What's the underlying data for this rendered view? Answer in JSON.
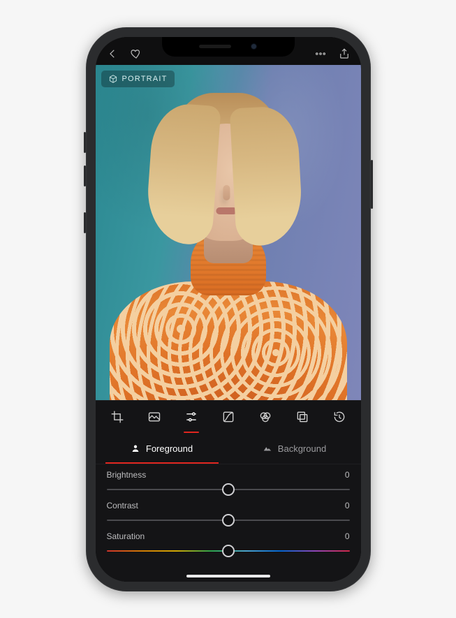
{
  "badge": {
    "label": "PORTRAIT"
  },
  "toolbar": {
    "tools": [
      {
        "name": "crop"
      },
      {
        "name": "presets"
      },
      {
        "name": "adjust",
        "active": true
      },
      {
        "name": "curves"
      },
      {
        "name": "color-mix"
      },
      {
        "name": "frame"
      },
      {
        "name": "history"
      }
    ]
  },
  "tabs": {
    "foreground": {
      "label": "Foreground",
      "active": true
    },
    "background": {
      "label": "Background",
      "active": false
    }
  },
  "sliders": [
    {
      "key": "brightness",
      "label": "Brightness",
      "value": 0
    },
    {
      "key": "contrast",
      "label": "Contrast",
      "value": 0
    },
    {
      "key": "saturation",
      "label": "Saturation",
      "value": 0
    }
  ],
  "colors": {
    "accent": "#e0261f"
  }
}
